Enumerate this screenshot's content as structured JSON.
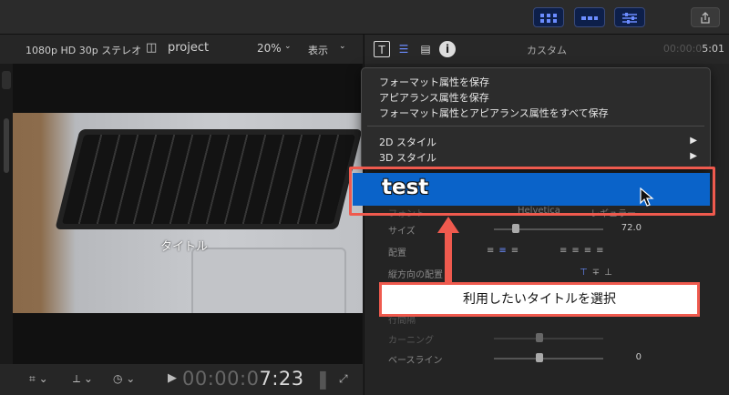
{
  "toolbar": {
    "icons": [
      "browser-layout-icon",
      "timeline-layout-icon",
      "inspector-toggle-icon",
      "share-icon"
    ],
    "accent": "#3a4a7a"
  },
  "viewer": {
    "format": "1080p HD 30p ステレオ",
    "project": "project",
    "zoom": "20%",
    "view_menu": "表示",
    "title_overlay": "タイトル",
    "timecode_dim": "00:00:0",
    "timecode_main": "7:23"
  },
  "inspector": {
    "title": "カスタム",
    "time_dim": "00:00:0",
    "time_main": "5:01",
    "rows": {
      "font_label": "フォント",
      "font_value": "Helvetica",
      "font_weight": "レギュラー",
      "size_label": "サイズ",
      "size_value": "72.0",
      "alignment_label": "配置",
      "vertical_label": "縦方向の配置",
      "line_spacing_label": "行間隔",
      "kerning_label": "カーニング",
      "baseline_label": "ベースライン",
      "baseline_value": "0"
    }
  },
  "menu": {
    "items": [
      "フォーマット属性を保存",
      "アピアランス属性を保存",
      "フォーマット属性とアピアランス属性をすべて保存",
      "2D スタイル",
      "3D スタイル"
    ],
    "highlighted": "test",
    "highlight_color": "#0a63c9"
  },
  "callout": {
    "text": "利用したいタイトルを選択",
    "color": "#ef5a4e"
  }
}
